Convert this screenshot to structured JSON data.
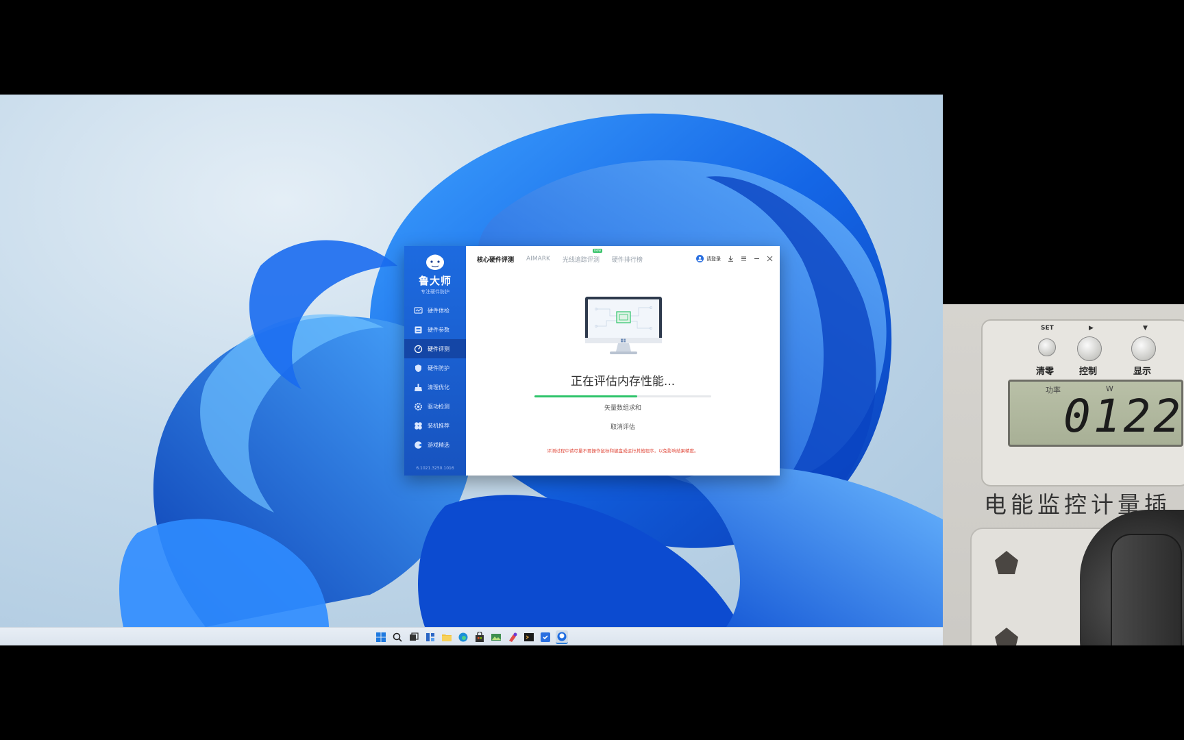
{
  "app": {
    "brand_name": "鲁大师",
    "brand_slogan": "专注硬件防护",
    "version": "6.1021.3250.1016",
    "nav": [
      {
        "label": "硬件体检",
        "icon": "chart-icon"
      },
      {
        "label": "硬件参数",
        "icon": "list-icon"
      },
      {
        "label": "硬件评测",
        "icon": "gauge-icon"
      },
      {
        "label": "硬件防护",
        "icon": "shield-icon"
      },
      {
        "label": "清理优化",
        "icon": "broom-icon"
      },
      {
        "label": "驱动检测",
        "icon": "gear-icon"
      },
      {
        "label": "装机推荐",
        "icon": "fan-icon"
      },
      {
        "label": "游戏精选",
        "icon": "game-icon"
      }
    ],
    "active_nav_index": 2,
    "tabs": [
      "核心硬件评测",
      "AIMARK",
      "光线追踪评测",
      "硬件排行榜"
    ],
    "new_badge": "new",
    "login_label": "请登录",
    "status_title": "正在评估内存性能...",
    "progress": 0.58,
    "progress_color": "#2ec46a",
    "sub_status": "矢量数组求和",
    "cancel_label": "取消评估",
    "warning": "评测过程中请尽量不要操作鼠标和键盘或运行其他程序，以免影响结果精度。"
  },
  "meter": {
    "btn_labels": [
      "SET",
      "▶",
      "▼"
    ],
    "btn_captions": [
      "清零",
      "控制",
      "显示"
    ],
    "lcd_units": [
      "功率",
      "W"
    ],
    "lcd_value": "0122",
    "label": "电能监控计量插"
  },
  "colors": {
    "accent": "#1d6be0",
    "warning": "#e0483a"
  }
}
